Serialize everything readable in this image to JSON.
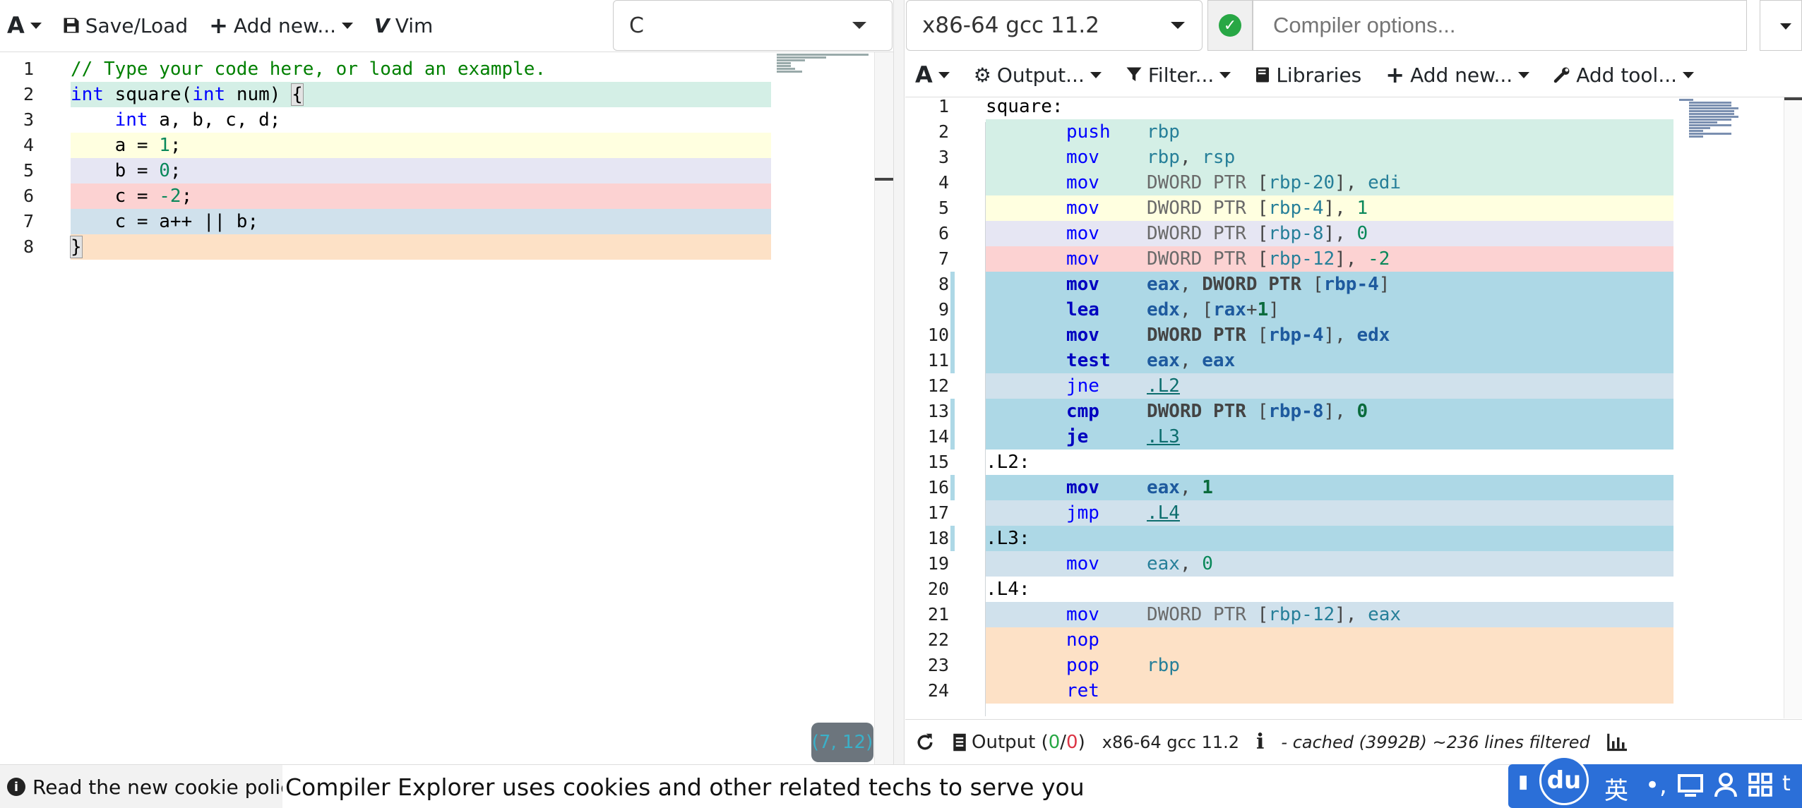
{
  "left_toolbar": {
    "font_icon": "A",
    "save_load": "Save/Load",
    "add_new": "Add new...",
    "vim": "Vim"
  },
  "language": {
    "selected": "C"
  },
  "source": {
    "lines": [
      {
        "n": "1",
        "color": "#ffffff"
      },
      {
        "n": "2",
        "color": "#d4efe6"
      },
      {
        "n": "3",
        "color": "#ffffff"
      },
      {
        "n": "4",
        "color": "#ffffe0"
      },
      {
        "n": "5",
        "color": "#e6e6f3"
      },
      {
        "n": "6",
        "color": "#fcd2d2"
      },
      {
        "n": "7",
        "color": "#d0e1ec"
      },
      {
        "n": "8",
        "color": "#fde1c6"
      }
    ],
    "tokens": {
      "l1": "// Type your code here, or load an example.",
      "l2_kw1": "int",
      "l2_fn": " square(",
      "l2_kw2": "int",
      "l2_rest": " num) ",
      "l2_brace": "{",
      "l3_kw": "int",
      "l3_rest": " a, b, c, d;",
      "l4_pre": "a = ",
      "l4_num": "1",
      "l4_end": ";",
      "l5_pre": "b = ",
      "l5_num": "0",
      "l5_end": ";",
      "l6_pre": "c = ",
      "l6_num": "-2",
      "l6_end": ";",
      "l7": "c = a++ || b;",
      "l8_brace": "}"
    }
  },
  "cursor_position": "(7, 12)",
  "compiler": {
    "selected": "x86-64 gcc 11.2",
    "options_placeholder": "Compiler options..."
  },
  "right_toolbar": {
    "font_icon": "A",
    "output": "Output...",
    "filter": "Filter...",
    "libraries": "Libraries",
    "add_new": "Add new...",
    "add_tool": "Add tool..."
  },
  "asm": {
    "lines": [
      {
        "n": "1",
        "label": "square:",
        "op": "",
        "args": "",
        "color": "#ffffff",
        "gutter": ""
      },
      {
        "n": "2",
        "label": "",
        "op": "push",
        "args": "rbp",
        "color": "#d4efe6",
        "gutter": ""
      },
      {
        "n": "3",
        "label": "",
        "op": "mov",
        "args": "rbp, rsp",
        "color": "#d4efe6",
        "gutter": ""
      },
      {
        "n": "4",
        "label": "",
        "op": "mov",
        "args": "DWORD PTR [rbp-20], edi",
        "color": "#d4efe6",
        "gutter": ""
      },
      {
        "n": "5",
        "label": "",
        "op": "mov",
        "args": "DWORD PTR [rbp-4], 1",
        "color": "#ffffe0",
        "gutter": ""
      },
      {
        "n": "6",
        "label": "",
        "op": "mov",
        "args": "DWORD PTR [rbp-8], 0",
        "color": "#e6e6f3",
        "gutter": ""
      },
      {
        "n": "7",
        "label": "",
        "op": "mov",
        "args": "DWORD PTR [rbp-12], -2",
        "color": "#fcd2d2",
        "gutter": ""
      },
      {
        "n": "8",
        "label": "",
        "op": "mov",
        "args": "eax, DWORD PTR [rbp-4]",
        "color": "#add8e6",
        "gutter": "#add8e6"
      },
      {
        "n": "9",
        "label": "",
        "op": "lea",
        "args": "edx, [rax+1]",
        "color": "#add8e6",
        "gutter": "#add8e6"
      },
      {
        "n": "10",
        "label": "",
        "op": "mov",
        "args": "DWORD PTR [rbp-4], edx",
        "color": "#add8e6",
        "gutter": "#add8e6"
      },
      {
        "n": "11",
        "label": "",
        "op": "test",
        "args": "eax, eax",
        "color": "#add8e6",
        "gutter": "#add8e6"
      },
      {
        "n": "12",
        "label": "",
        "op": "jne",
        "args": ".L2",
        "color": "#d0e1ec",
        "gutter": ""
      },
      {
        "n": "13",
        "label": "",
        "op": "cmp",
        "args": "DWORD PTR [rbp-8], 0",
        "color": "#add8e6",
        "gutter": "#add8e6"
      },
      {
        "n": "14",
        "label": "",
        "op": "je",
        "args": ".L3",
        "color": "#add8e6",
        "gutter": "#add8e6"
      },
      {
        "n": "15",
        "label": ".L2:",
        "op": "",
        "args": "",
        "color": "#ffffff",
        "gutter": ""
      },
      {
        "n": "16",
        "label": "",
        "op": "mov",
        "args": "eax, 1",
        "color": "#add8e6",
        "gutter": "#add8e6"
      },
      {
        "n": "17",
        "label": "",
        "op": "jmp",
        "args": ".L4",
        "color": "#d0e1ec",
        "gutter": ""
      },
      {
        "n": "18",
        "label": ".L3:",
        "op": "",
        "args": "",
        "color": "#add8e6",
        "gutter": "#add8e6"
      },
      {
        "n": "19",
        "label": "",
        "op": "mov",
        "args": "eax, 0",
        "color": "#d0e1ec",
        "gutter": ""
      },
      {
        "n": "20",
        "label": ".L4:",
        "op": "",
        "args": "",
        "color": "#ffffff",
        "gutter": ""
      },
      {
        "n": "21",
        "label": "",
        "op": "mov",
        "args": "DWORD PTR [rbp-12], eax",
        "color": "#d0e1ec",
        "gutter": ""
      },
      {
        "n": "22",
        "label": "",
        "op": "nop",
        "args": "",
        "color": "#fde1c6",
        "gutter": ""
      },
      {
        "n": "23",
        "label": "",
        "op": "pop",
        "args": "rbp",
        "color": "#fde1c6",
        "gutter": ""
      },
      {
        "n": "24",
        "label": "",
        "op": "ret",
        "args": "",
        "color": "#fde1c6",
        "gutter": ""
      }
    ]
  },
  "bottom_bar": {
    "output_label": "Output (",
    "ok_count": "0",
    "slash": "/",
    "err_count": "0",
    "close_paren": ")",
    "compiler": "x86-64 gcc 11.2",
    "cache_info": "- cached (3992B) ~236 lines filtered"
  },
  "cookie": {
    "policy_link": "Read the new cookie policy",
    "message": "Compiler Explorer uses cookies and other related techs to serve you"
  },
  "ime": {
    "logo": "du",
    "lang": "英",
    "punct": "•,",
    "tail": "t"
  },
  "icons": {
    "save": "floppy-disk",
    "add": "plus",
    "vim": "vim-logo",
    "status": "check-circle",
    "output": "gear",
    "filter": "funnel",
    "libraries": "book",
    "tool": "wrench",
    "refresh": "refresh",
    "output_doc": "document",
    "info": "info-circle",
    "stats": "bar-chart"
  },
  "colors": {
    "ok_green": "#28a745",
    "error_red": "#dc3545",
    "ime_blue": "#2b6fd8"
  }
}
